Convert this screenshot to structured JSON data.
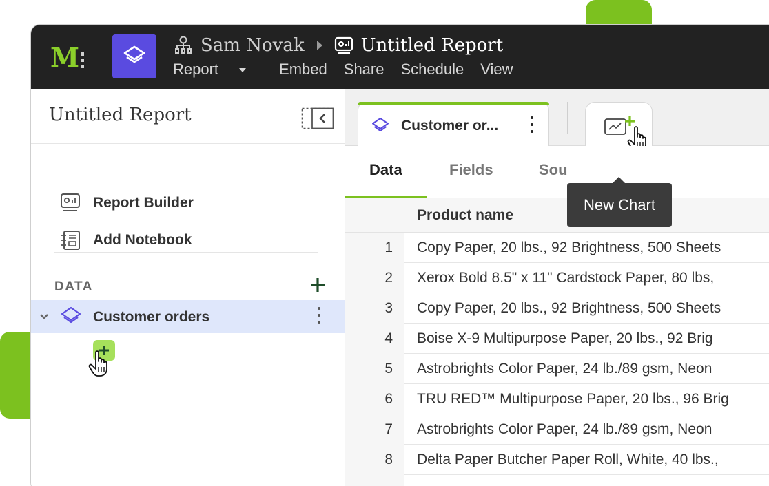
{
  "header": {
    "user": "Sam Novak",
    "report_title": "Untitled Report",
    "menu": [
      "Report",
      "Embed",
      "Share",
      "Schedule",
      "View"
    ]
  },
  "sidebar": {
    "title": "Untitled Report",
    "items": [
      {
        "label": "Report Builder",
        "icon": "report-builder-icon"
      },
      {
        "label": "Add Notebook",
        "icon": "notebook-icon"
      }
    ],
    "data_label": "DATA",
    "dataset": "Customer orders"
  },
  "chart_tab": {
    "label": "Customer or..."
  },
  "tooltip": "New Chart",
  "subtabs": [
    "Data",
    "Fields",
    "Sou"
  ],
  "table": {
    "header": "Product name",
    "rows": [
      {
        "index": "1",
        "name": "Copy Paper, 20 lbs., 92 Brightness, 500 Sheets"
      },
      {
        "index": "2",
        "name": "Xerox Bold 8.5\" x 11\" Cardstock Paper, 80 lbs,"
      },
      {
        "index": "3",
        "name": "Copy Paper, 20 lbs., 92 Brightness, 500 Sheets"
      },
      {
        "index": "4",
        "name": "Boise X-9 Multipurpose Paper, 20 lbs., 92 Brig"
      },
      {
        "index": "5",
        "name": "Astrobrights Color Paper, 24 lb./89 gsm, Neon"
      },
      {
        "index": "6",
        "name": "TRU RED™ Multipurpose Paper, 20 lbs., 96 Brig"
      },
      {
        "index": "7",
        "name": "Astrobrights Color Paper, 24 lb./89 gsm, Neon"
      },
      {
        "index": "8",
        "name": "Delta Paper Butcher Paper Roll, White, 40 lbs.,"
      }
    ]
  },
  "colors": {
    "accent_green": "#7cc11f",
    "topbar": "#222222",
    "app_icon": "#5a4be0",
    "selected_row": "#dfe7fb"
  }
}
